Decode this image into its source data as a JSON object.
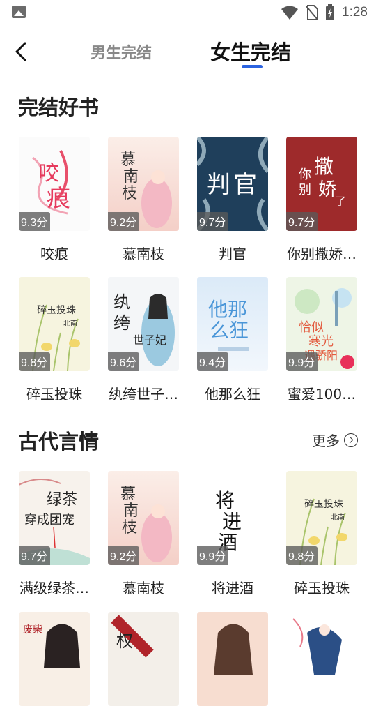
{
  "status": {
    "time": "1:28"
  },
  "header": {
    "tabs": [
      {
        "label": "男生完结"
      },
      {
        "label": "女生完结"
      }
    ]
  },
  "section1": {
    "title": "完结好书",
    "books": [
      {
        "title": "咬痕",
        "rating": "9.3分",
        "cover_text": "咬痕"
      },
      {
        "title": "慕南枝",
        "rating": "9.2分",
        "cover_text": "慕南枝"
      },
      {
        "title": "判官",
        "rating": "9.7分",
        "cover_text": "判官"
      },
      {
        "title": "你别撒娇…",
        "rating": "9.7分",
        "cover_text": "你别撒娇了"
      },
      {
        "title": "碎玉投珠",
        "rating": "9.8分",
        "cover_text": "碎玉投珠"
      },
      {
        "title": "纨绔世子…",
        "rating": "9.6分",
        "cover_text": "纨绔世子妃"
      },
      {
        "title": "他那么狂",
        "rating": "9.4分",
        "cover_text": "他那么狂"
      },
      {
        "title": "蜜爱100…",
        "rating": "9.9分",
        "cover_text": "恰似寒光遇骄阳"
      }
    ]
  },
  "section2": {
    "title": "古代言情",
    "more_label": "更多",
    "books": [
      {
        "title": "满级绿茶…",
        "rating": "9.7分",
        "cover_text": "绿茶穿成团宠"
      },
      {
        "title": "慕南枝",
        "rating": "9.2分",
        "cover_text": "慕南枝"
      },
      {
        "title": "将进酒",
        "rating": "9.9分",
        "cover_text": "将进酒"
      },
      {
        "title": "碎玉投珠",
        "rating": "9.8分",
        "cover_text": "碎玉投珠"
      }
    ]
  }
}
